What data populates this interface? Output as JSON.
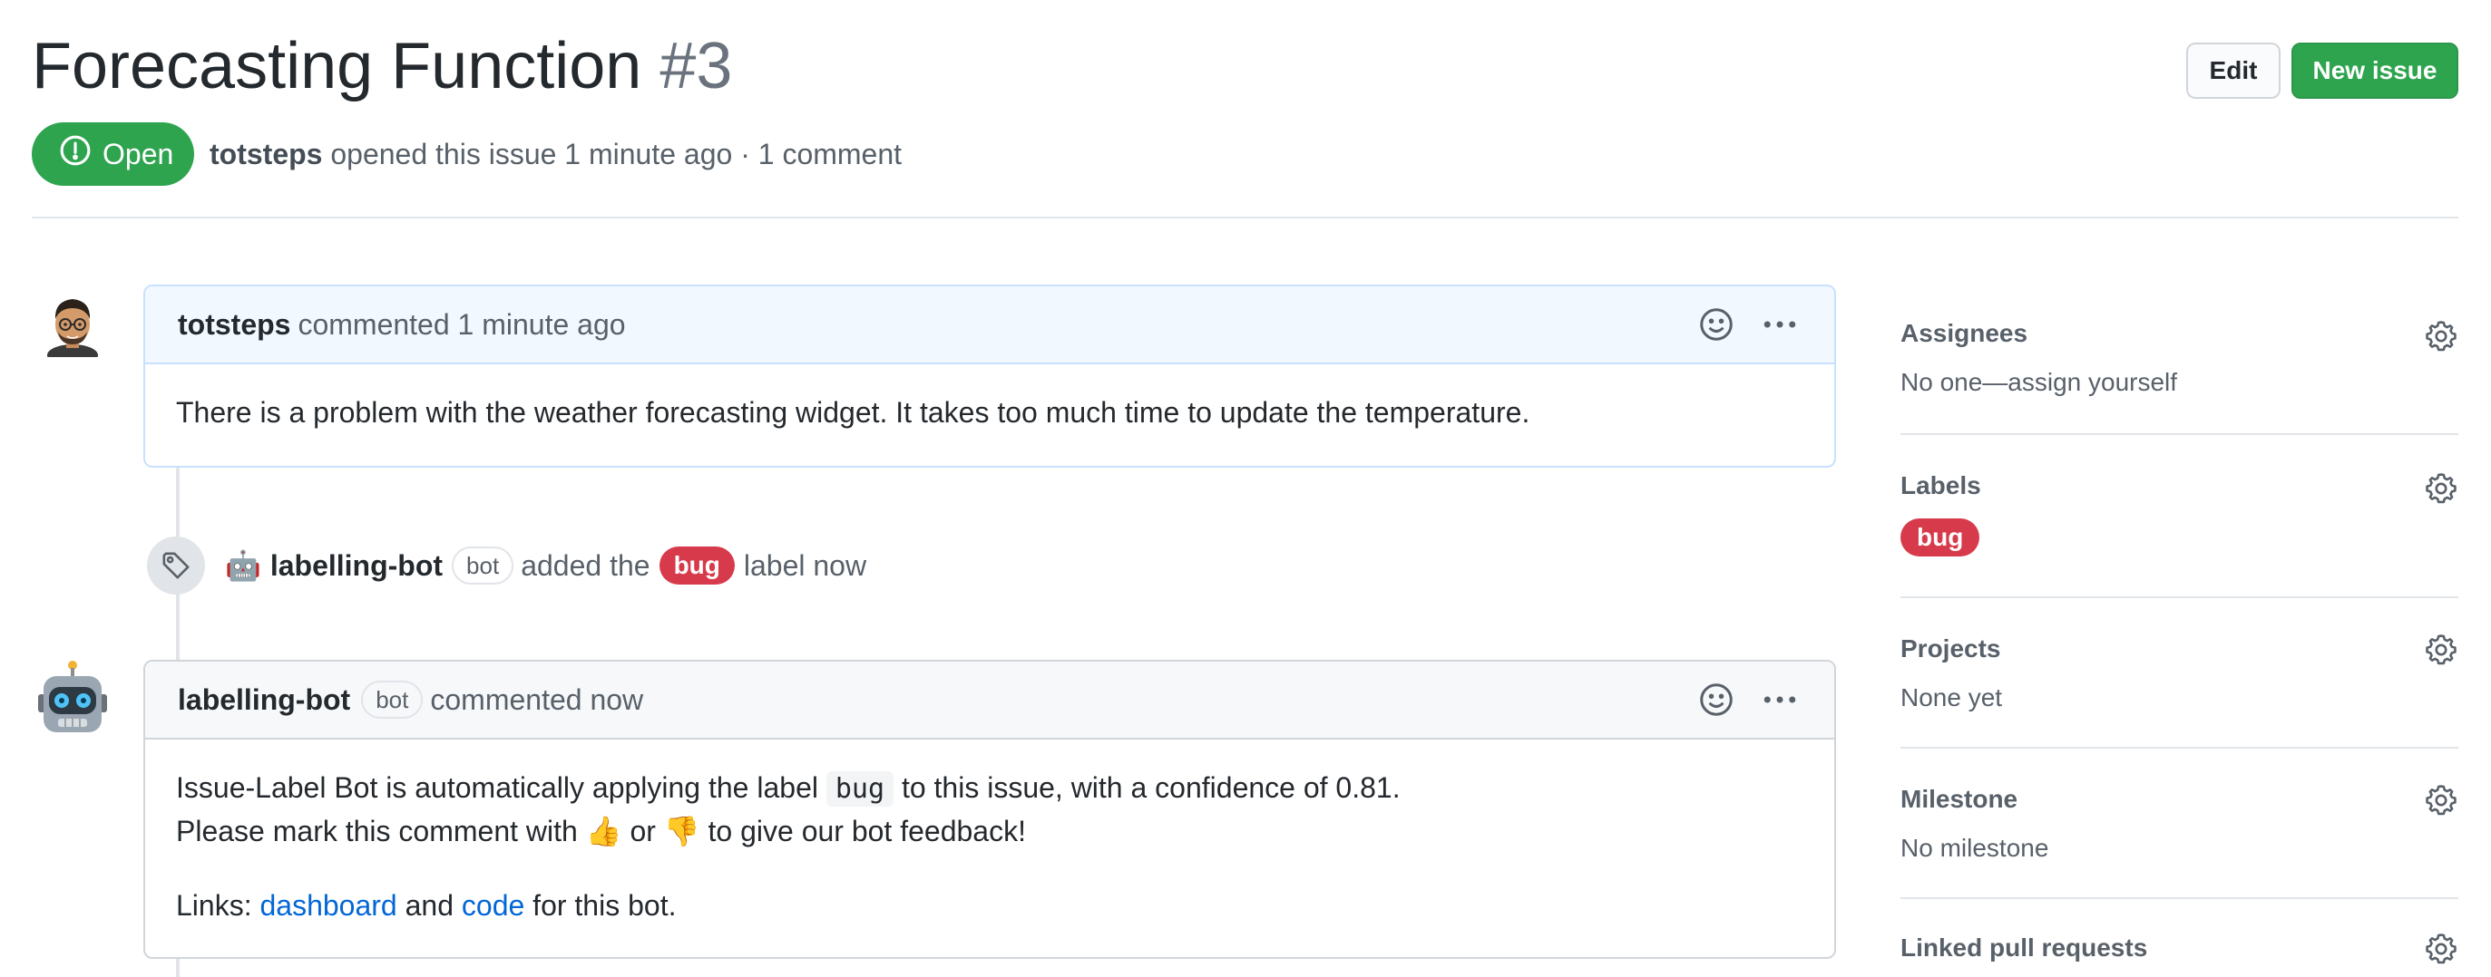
{
  "issue": {
    "title": "Forecasting Function",
    "number": "#3",
    "state": "Open",
    "author": "totsteps",
    "meta_text": "opened this issue 1 minute ago · 1 comment"
  },
  "header_buttons": {
    "edit_label": "Edit",
    "new_issue_label": "New issue"
  },
  "comments": [
    {
      "author": "totsteps",
      "action": "commented 1 minute ago",
      "body": "There is a problem with the weather forecasting widget. It takes too much time to update the temperature."
    },
    {
      "author": "labelling-bot",
      "badge": "bot",
      "action": "commented now",
      "body_line1_a": "Issue-Label Bot is automatically applying the label",
      "body_line1_code": "bug",
      "body_line1_b": "to this issue, with a confidence of 0.81.",
      "body_line2_a": "Please mark this comment with",
      "body_line2_thumbsup": "👍",
      "body_line2_or": "or",
      "body_line2_thumbsdown": "👎",
      "body_line2_b": "to give our bot feedback!",
      "links_prefix": "Links:",
      "link_dashboard": "dashboard",
      "links_and": "and",
      "link_code": "code",
      "links_suffix": "for this bot."
    }
  ],
  "event": {
    "actor_emoji": "🤖",
    "actor": "labelling-bot",
    "badge": "bot",
    "text_before": "added the",
    "label": "bug",
    "text_after": "label now"
  },
  "sidebar": {
    "assignees": {
      "title": "Assignees",
      "value": "No one—assign yourself"
    },
    "labels": {
      "title": "Labels",
      "label": "bug"
    },
    "projects": {
      "title": "Projects",
      "value": "None yet"
    },
    "milestone": {
      "title": "Milestone",
      "value": "No milestone"
    },
    "linked_prs": {
      "title": "Linked pull requests"
    }
  },
  "colors": {
    "open_green": "#2ea44f",
    "bug_label": "#d73a4a",
    "link_blue": "#0366d6"
  }
}
